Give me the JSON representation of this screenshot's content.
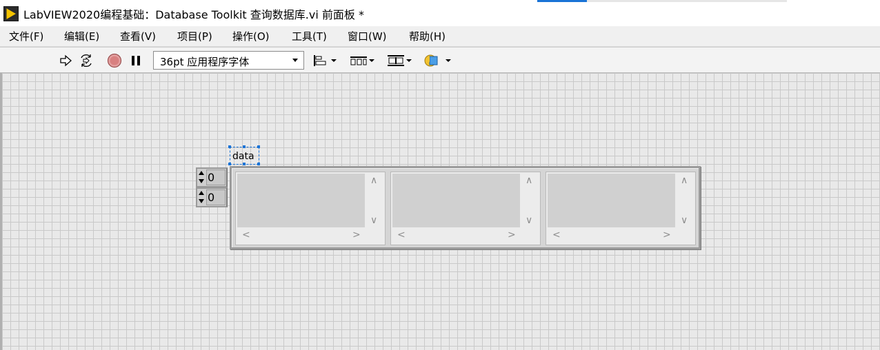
{
  "window": {
    "title": "LabVIEW2020编程基础：Database Toolkit 查询数据库.vi 前面板 *",
    "app_icon": "labview-run-icon"
  },
  "menu": {
    "items": [
      {
        "label": "文件(F)"
      },
      {
        "label": "编辑(E)"
      },
      {
        "label": "查看(V)"
      },
      {
        "label": "项目(P)"
      },
      {
        "label": "操作(O)"
      },
      {
        "label": "工具(T)"
      },
      {
        "label": "窗口(W)"
      },
      {
        "label": "帮助(H)"
      }
    ]
  },
  "toolbar": {
    "buttons": [
      {
        "name": "run-arrow-icon"
      },
      {
        "name": "run-continuously-icon"
      },
      {
        "name": "abort-icon"
      },
      {
        "name": "pause-icon"
      },
      {
        "name": "align-objects-icon"
      },
      {
        "name": "distribute-objects-icon"
      },
      {
        "name": "resize-objects-icon"
      },
      {
        "name": "reorder-icon"
      }
    ],
    "font_select": {
      "value": "36pt 应用程序字体"
    }
  },
  "front_panel": {
    "array_label": "data",
    "index_values": [
      "0",
      "0"
    ],
    "accent_color": "#1a73d6"
  }
}
